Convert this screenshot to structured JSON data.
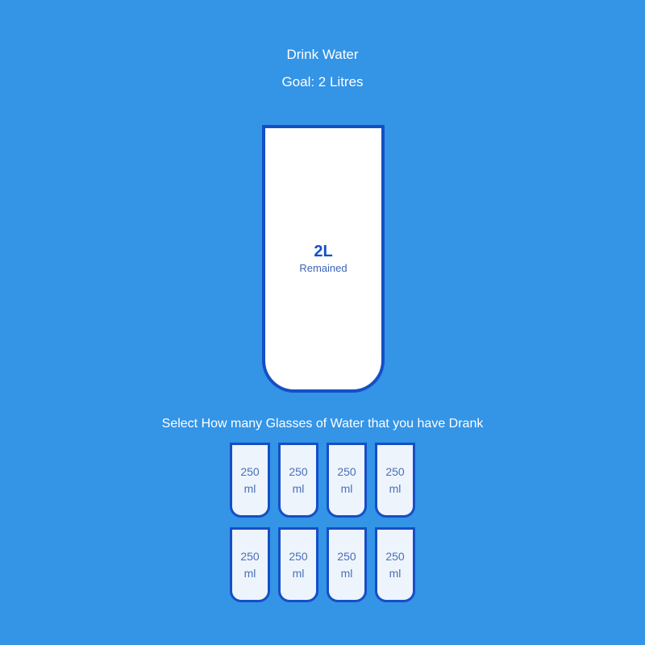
{
  "app": {
    "title": "Drink Water",
    "goal": "Goal: 2 Litres"
  },
  "main_cup": {
    "remaining_value": "2L",
    "remaining_label": "Remained",
    "fill_fraction": 0
  },
  "selector": {
    "instruction": "Select How many Glasses of Water that you have Drank",
    "cups": [
      {
        "amount": "250",
        "unit": "ml"
      },
      {
        "amount": "250",
        "unit": "ml"
      },
      {
        "amount": "250",
        "unit": "ml"
      },
      {
        "amount": "250",
        "unit": "ml"
      },
      {
        "amount": "250",
        "unit": "ml"
      },
      {
        "amount": "250",
        "unit": "ml"
      },
      {
        "amount": "250",
        "unit": "ml"
      },
      {
        "amount": "250",
        "unit": "ml"
      }
    ]
  },
  "colors": {
    "background": "#3494e6",
    "cup_border": "#144fc6",
    "cup_fill": "#ffffff",
    "small_cup_fill": "#eef4fc"
  }
}
